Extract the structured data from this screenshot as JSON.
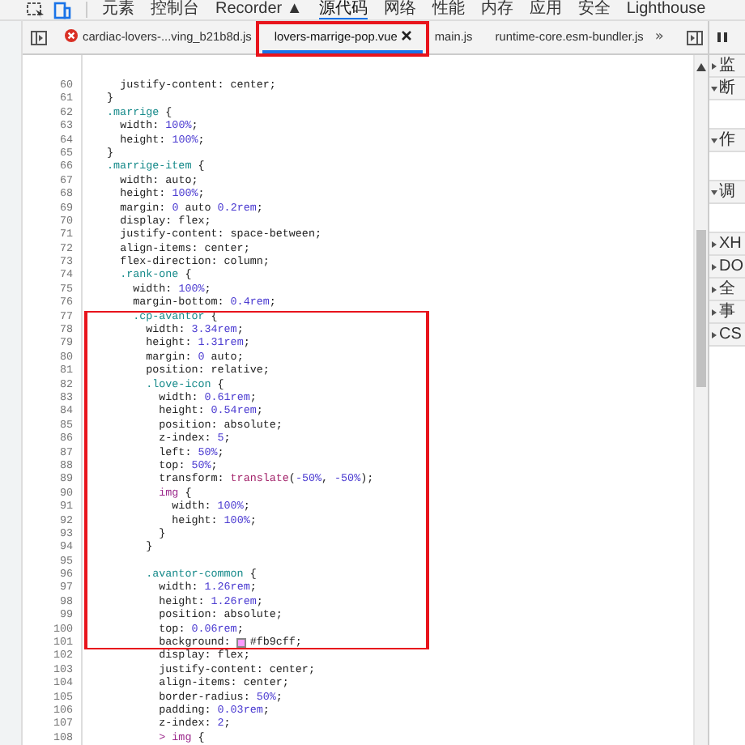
{
  "toolbar": {
    "tabs": [
      {
        "label": "元素",
        "selected": false
      },
      {
        "label": "控制台",
        "selected": false
      },
      {
        "label": "Recorder ▲",
        "selected": false
      },
      {
        "label": "源代码",
        "selected": true
      },
      {
        "label": "网络",
        "selected": false
      },
      {
        "label": "性能",
        "selected": false
      },
      {
        "label": "内存",
        "selected": false
      },
      {
        "label": "应用",
        "selected": false
      },
      {
        "label": "安全",
        "selected": false
      },
      {
        "label": "Lighthouse",
        "selected": false
      }
    ]
  },
  "file_tabs": [
    {
      "label": "cardiac-lovers-...ving_b21b8d.js",
      "selected": false,
      "error": true,
      "boxed": false
    },
    {
      "label": "lovers-marrige-pop.vue",
      "selected": true,
      "error": false,
      "boxed": true
    },
    {
      "label": "main.js",
      "selected": false,
      "error": false,
      "boxed": false
    },
    {
      "label": "runtime-core.esm-bundler.js",
      "selected": false,
      "error": false,
      "boxed": false
    }
  ],
  "more_tabs": "»",
  "lines": [
    {
      "num": "60",
      "text": "    justify-content: center;",
      "boxed": false
    },
    {
      "num": "61",
      "text": "  }",
      "boxed": false
    },
    {
      "num": "62",
      "text": "  .marrige {",
      "boxed": false
    },
    {
      "num": "63",
      "text": "    width: 100%;",
      "boxed": false
    },
    {
      "num": "64",
      "text": "    height: 100%;",
      "boxed": false
    },
    {
      "num": "65",
      "text": "  }",
      "boxed": false
    },
    {
      "num": "66",
      "text": "  .marrige-item {",
      "boxed": false
    },
    {
      "num": "67",
      "text": "    width: auto;",
      "boxed": false
    },
    {
      "num": "68",
      "text": "    height: 100%;",
      "boxed": false
    },
    {
      "num": "69",
      "text": "    margin: 0 auto 0.2rem;",
      "boxed": false
    },
    {
      "num": "70",
      "text": "    display: flex;",
      "boxed": false
    },
    {
      "num": "71",
      "text": "    justify-content: space-between;",
      "boxed": false
    },
    {
      "num": "72",
      "text": "    align-items: center;",
      "boxed": false
    },
    {
      "num": "73",
      "text": "    flex-direction: column;",
      "boxed": false
    },
    {
      "num": "74",
      "text": "    .rank-one {",
      "boxed": false
    },
    {
      "num": "75",
      "text": "      width: 100%;",
      "boxed": false
    },
    {
      "num": "76",
      "text": "      margin-bottom: 0.4rem;",
      "boxed": false
    },
    {
      "num": "77",
      "text": "      .cp-avantor {",
      "boxed": true
    },
    {
      "num": "78",
      "text": "        width: 3.34rem;",
      "boxed": true
    },
    {
      "num": "79",
      "text": "        height: 1.31rem;",
      "boxed": true
    },
    {
      "num": "80",
      "text": "        margin: 0 auto;",
      "boxed": true
    },
    {
      "num": "81",
      "text": "        position: relative;",
      "boxed": true
    },
    {
      "num": "82",
      "text": "        .love-icon {",
      "boxed": true
    },
    {
      "num": "83",
      "text": "          width: 0.61rem;",
      "boxed": true
    },
    {
      "num": "84",
      "text": "          height: 0.54rem;",
      "boxed": true
    },
    {
      "num": "85",
      "text": "          position: absolute;",
      "boxed": true
    },
    {
      "num": "86",
      "text": "          z-index: 5;",
      "boxed": true
    },
    {
      "num": "87",
      "text": "          left: 50%;",
      "boxed": true
    },
    {
      "num": "88",
      "text": "          top: 50%;",
      "boxed": true
    },
    {
      "num": "89",
      "text": "          transform: translate(-50%, -50%);",
      "boxed": true
    },
    {
      "num": "90",
      "text": "          img {",
      "boxed": true
    },
    {
      "num": "91",
      "text": "            width: 100%;",
      "boxed": true
    },
    {
      "num": "92",
      "text": "            height: 100%;",
      "boxed": true
    },
    {
      "num": "93",
      "text": "          }",
      "boxed": true
    },
    {
      "num": "94",
      "text": "        }",
      "boxed": true
    },
    {
      "num": "95",
      "boxed": true
    },
    {
      "num": "96",
      "text": "        .avantor-common {",
      "boxed": true
    },
    {
      "num": "97",
      "text": "          width: 1.26rem;",
      "boxed": true
    },
    {
      "num": "98",
      "text": "          height: 1.26rem;",
      "boxed": true
    },
    {
      "num": "99",
      "text": "          position: absolute;",
      "boxed": true
    },
    {
      "num": "100",
      "text": "          top: 0.06rem;",
      "boxed": true
    },
    {
      "num": "101",
      "text": "          background: #fb9cff;",
      "boxed": true,
      "color": "#fb9cff"
    },
    {
      "num": "102",
      "text": "          display: flex;",
      "boxed": false
    },
    {
      "num": "103",
      "text": "          justify-content: center;",
      "boxed": false
    },
    {
      "num": "104",
      "text": "          align-items: center;",
      "boxed": false
    },
    {
      "num": "105",
      "text": "          border-radius: 50%;",
      "boxed": false
    },
    {
      "num": "106",
      "text": "          padding: 0.03rem;",
      "boxed": false
    },
    {
      "num": "107",
      "text": "          z-index: 2;",
      "boxed": false
    },
    {
      "num": "108",
      "text": "          > img {",
      "boxed": false
    }
  ],
  "debugger_sections": [
    {
      "label": "监",
      "expanded": false
    },
    {
      "label": "断",
      "expanded": true
    },
    {
      "label": "作",
      "expanded": true
    },
    {
      "label": "调",
      "expanded": true
    },
    {
      "label": "XH",
      "expanded": false
    },
    {
      "label": "DO",
      "expanded": false
    },
    {
      "label": "全",
      "expanded": false
    },
    {
      "label": "事",
      "expanded": false
    },
    {
      "label": "CS",
      "expanded": false
    }
  ]
}
